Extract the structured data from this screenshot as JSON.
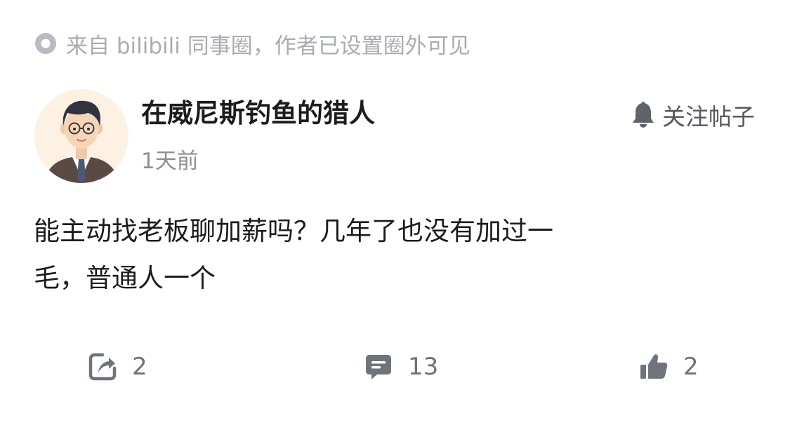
{
  "source": {
    "text": "来自 bilibili 同事圈，作者已设置圈外可见",
    "icon": "circle-dot-icon"
  },
  "author": {
    "name": "在威尼斯钓鱼的猎人",
    "time": "1天前",
    "avatar": "cartoon-man-with-glasses-avatar"
  },
  "follow": {
    "label": "关注帖子",
    "icon": "bell-icon"
  },
  "post": {
    "line1": "能主动找老板聊加薪吗？几年了也没有加过一",
    "line2": "毛，普通人一个"
  },
  "actions": {
    "share": {
      "icon": "share-icon",
      "count": "2"
    },
    "comment": {
      "icon": "comment-icon",
      "count": "13"
    },
    "like": {
      "icon": "thumbs-up-icon",
      "count": "2"
    }
  },
  "colors": {
    "muted": "#a9acb3",
    "text": "#1c1c1c",
    "icon": "#6f737a",
    "background": "#ffffff"
  }
}
